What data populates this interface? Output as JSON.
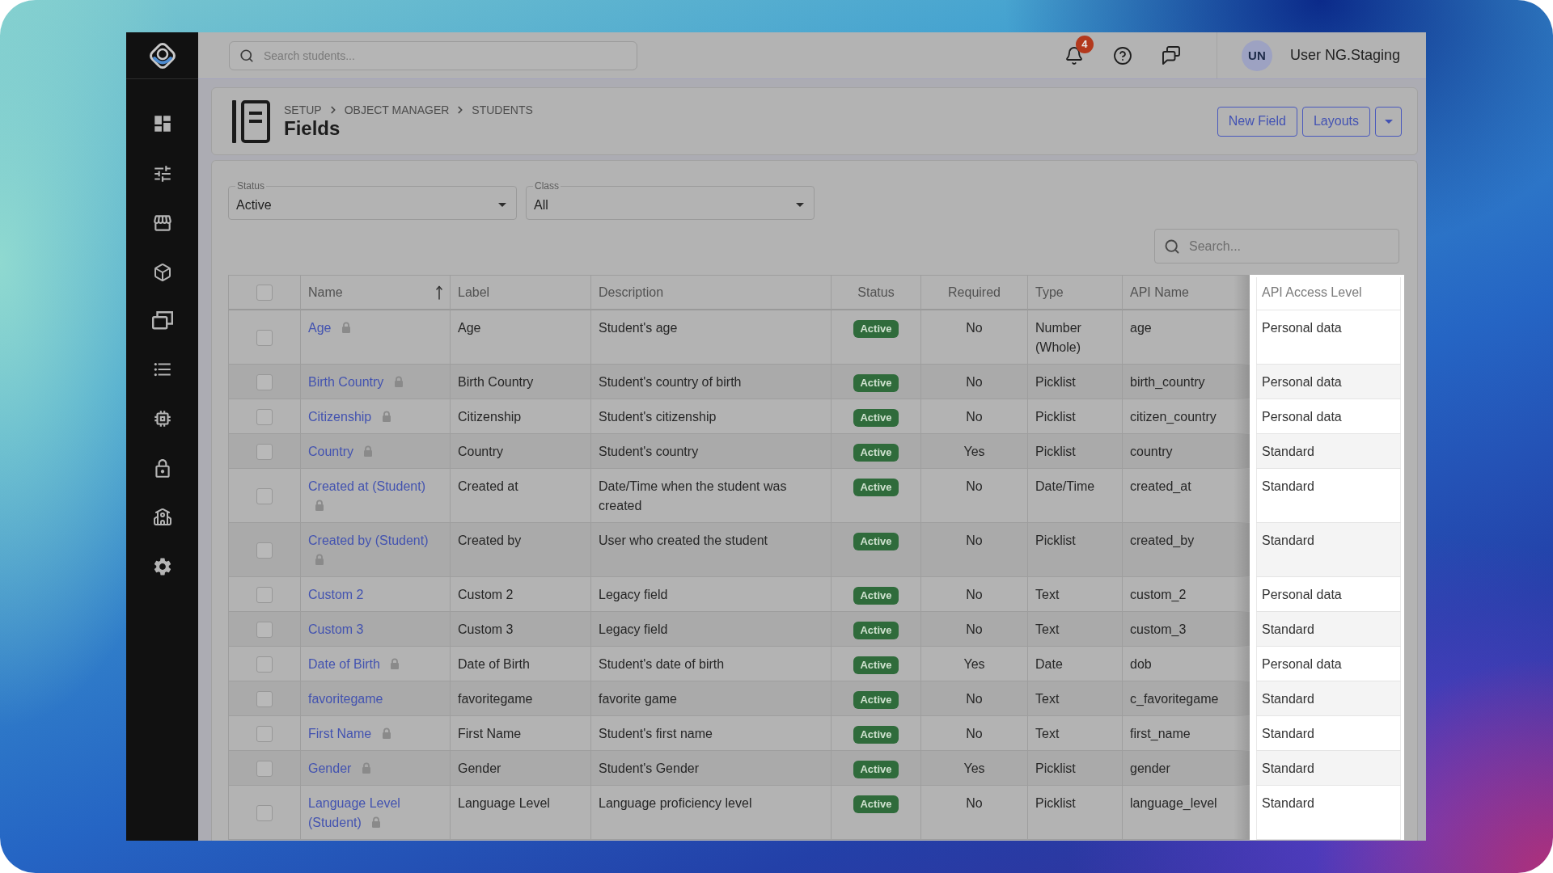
{
  "top_bar": {
    "search": {
      "placeholder": "Search students..."
    },
    "notifications": {
      "count": "4"
    },
    "user": {
      "initials": "UN",
      "name": "User NG.Staging"
    }
  },
  "page_header": {
    "breadcrumb": [
      "SETUP",
      "OBJECT MANAGER",
      "STUDENTS"
    ],
    "title": "Fields",
    "buttons": [
      "New Field",
      "Layouts"
    ]
  },
  "filters": [
    {
      "label": "Status",
      "value": "Active"
    },
    {
      "label": "Class",
      "value": "All"
    }
  ],
  "table_search": {
    "placeholder": "Search..."
  },
  "table": {
    "select_all": {
      "checked": false
    },
    "columns": [
      {
        "label": "Name",
        "sorted": true,
        "highlighted": false
      },
      {
        "label": "Label",
        "sorted": false,
        "highlighted": false
      },
      {
        "label": "Description",
        "sorted": false,
        "highlighted": false
      },
      {
        "label": "Status",
        "sorted": false,
        "highlighted": false
      },
      {
        "label": "Required",
        "sorted": false,
        "highlighted": false
      },
      {
        "label": "Type",
        "sorted": false,
        "highlighted": false
      },
      {
        "label": "API Name",
        "sorted": false,
        "highlighted": false
      },
      {
        "label": "API Access Level",
        "sorted": false,
        "highlighted": true
      }
    ],
    "rows": [
      {
        "checked": false,
        "name": "Age",
        "locked": true,
        "label": "Age",
        "description": "Student's age",
        "status": "Active",
        "required": "No",
        "type": "Number (Whole)",
        "api_name": "age",
        "api_access_level": "Personal data"
      },
      {
        "checked": false,
        "name": "Birth Country",
        "locked": true,
        "label": "Birth Country",
        "description": "Student's country of birth",
        "status": "Active",
        "required": "No",
        "type": "Picklist",
        "api_name": "birth_country",
        "api_access_level": "Personal data"
      },
      {
        "checked": false,
        "name": "Citizenship",
        "locked": true,
        "label": "Citizenship",
        "description": "Student's citizenship",
        "status": "Active",
        "required": "No",
        "type": "Picklist",
        "api_name": "citizen_country",
        "api_access_level": "Personal data"
      },
      {
        "checked": false,
        "name": "Country",
        "locked": true,
        "label": "Country",
        "description": "Student's country",
        "status": "Active",
        "required": "Yes",
        "type": "Picklist",
        "api_name": "country",
        "api_access_level": "Standard"
      },
      {
        "checked": false,
        "name": "Created at (Student)",
        "locked": true,
        "label": "Created at",
        "description": "Date/Time when the student was created",
        "status": "Active",
        "required": "No",
        "type": "Date/Time",
        "api_name": "created_at",
        "api_access_level": "Standard"
      },
      {
        "checked": false,
        "name": "Created by (Student)",
        "locked": true,
        "label": "Created by",
        "description": "User who created the student",
        "status": "Active",
        "required": "No",
        "type": "Picklist",
        "api_name": "created_by",
        "api_access_level": "Standard"
      },
      {
        "checked": false,
        "name": "Custom 2",
        "locked": false,
        "label": "Custom 2",
        "description": "Legacy field",
        "status": "Active",
        "required": "No",
        "type": "Text",
        "api_name": "custom_2",
        "api_access_level": "Personal data"
      },
      {
        "checked": false,
        "name": "Custom 3",
        "locked": false,
        "label": "Custom 3",
        "description": "Legacy field",
        "status": "Active",
        "required": "No",
        "type": "Text",
        "api_name": "custom_3",
        "api_access_level": "Standard"
      },
      {
        "checked": false,
        "name": "Date of Birth",
        "locked": true,
        "label": "Date of Birth",
        "description": "Student's date of birth",
        "status": "Active",
        "required": "Yes",
        "type": "Date",
        "api_name": "dob",
        "api_access_level": "Personal data"
      },
      {
        "checked": false,
        "name": "favoritegame",
        "locked": false,
        "label": "favoritegame",
        "description": "favorite game",
        "status": "Active",
        "required": "No",
        "type": "Text",
        "api_name": "c_favoritegame",
        "api_access_level": "Standard"
      },
      {
        "checked": false,
        "name": "First Name",
        "locked": true,
        "label": "First Name",
        "description": "Student's first name",
        "status": "Active",
        "required": "No",
        "type": "Text",
        "api_name": "first_name",
        "api_access_level": "Standard"
      },
      {
        "checked": false,
        "name": "Gender",
        "locked": true,
        "label": "Gender",
        "description": "Student's Gender",
        "status": "Active",
        "required": "Yes",
        "type": "Picklist",
        "api_name": "gender",
        "api_access_level": "Standard"
      },
      {
        "checked": false,
        "name": "Language Level (Student)",
        "locked": true,
        "label": "Language Level",
        "description": "Language proficiency level",
        "status": "Active",
        "required": "No",
        "type": "Picklist",
        "api_name": "language_level",
        "api_access_level": "Standard"
      }
    ]
  }
}
